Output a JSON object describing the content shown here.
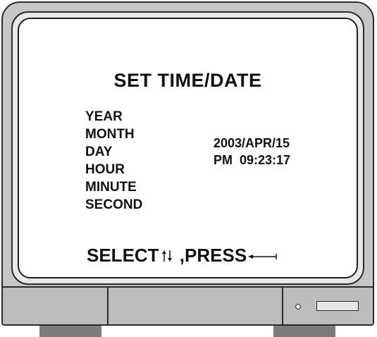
{
  "screen": {
    "title": "SET TIME/DATE",
    "fields": [
      "YEAR",
      "MONTH",
      "DAY",
      "HOUR",
      "MINUTE",
      "SECOND"
    ],
    "date_value": "2003/APR/15",
    "time_value": "PM  09:23:17"
  },
  "footer": {
    "select_label": "SELECT",
    "press_label": " ,PRESS",
    "select_icon": "up-down-arrows-icon",
    "press_icon": "enter-arrow-icon"
  },
  "colors": {
    "text": "#111111",
    "bezel": "#c6c6c6",
    "screen": "#ffffff"
  }
}
